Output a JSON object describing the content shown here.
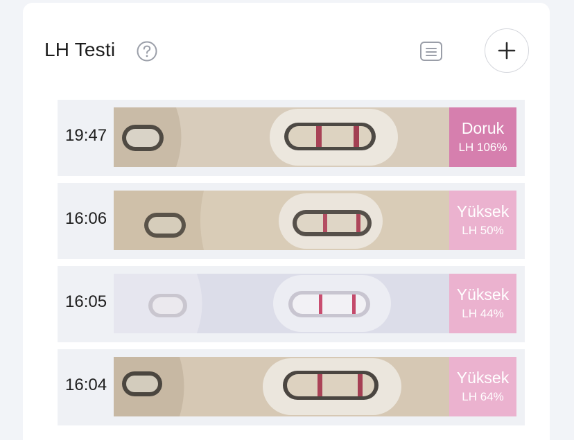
{
  "header": {
    "title": "LH Testi"
  },
  "icons": {
    "help": "help-circle-icon",
    "list": "list-icon",
    "add": "plus-icon"
  },
  "tests": [
    {
      "time": "19:47",
      "level": "Doruk",
      "value": "LH 106%",
      "status": "peak"
    },
    {
      "time": "16:06",
      "level": "Yüksek",
      "value": "LH 50%",
      "status": "high"
    },
    {
      "time": "16:05",
      "level": "Yüksek",
      "value": "LH 44%",
      "status": "high"
    },
    {
      "time": "16:04",
      "level": "Yüksek",
      "value": "LH 64%",
      "status": "high"
    }
  ],
  "colors": {
    "peak": "#d67fae",
    "high": "#ebb2cf"
  }
}
